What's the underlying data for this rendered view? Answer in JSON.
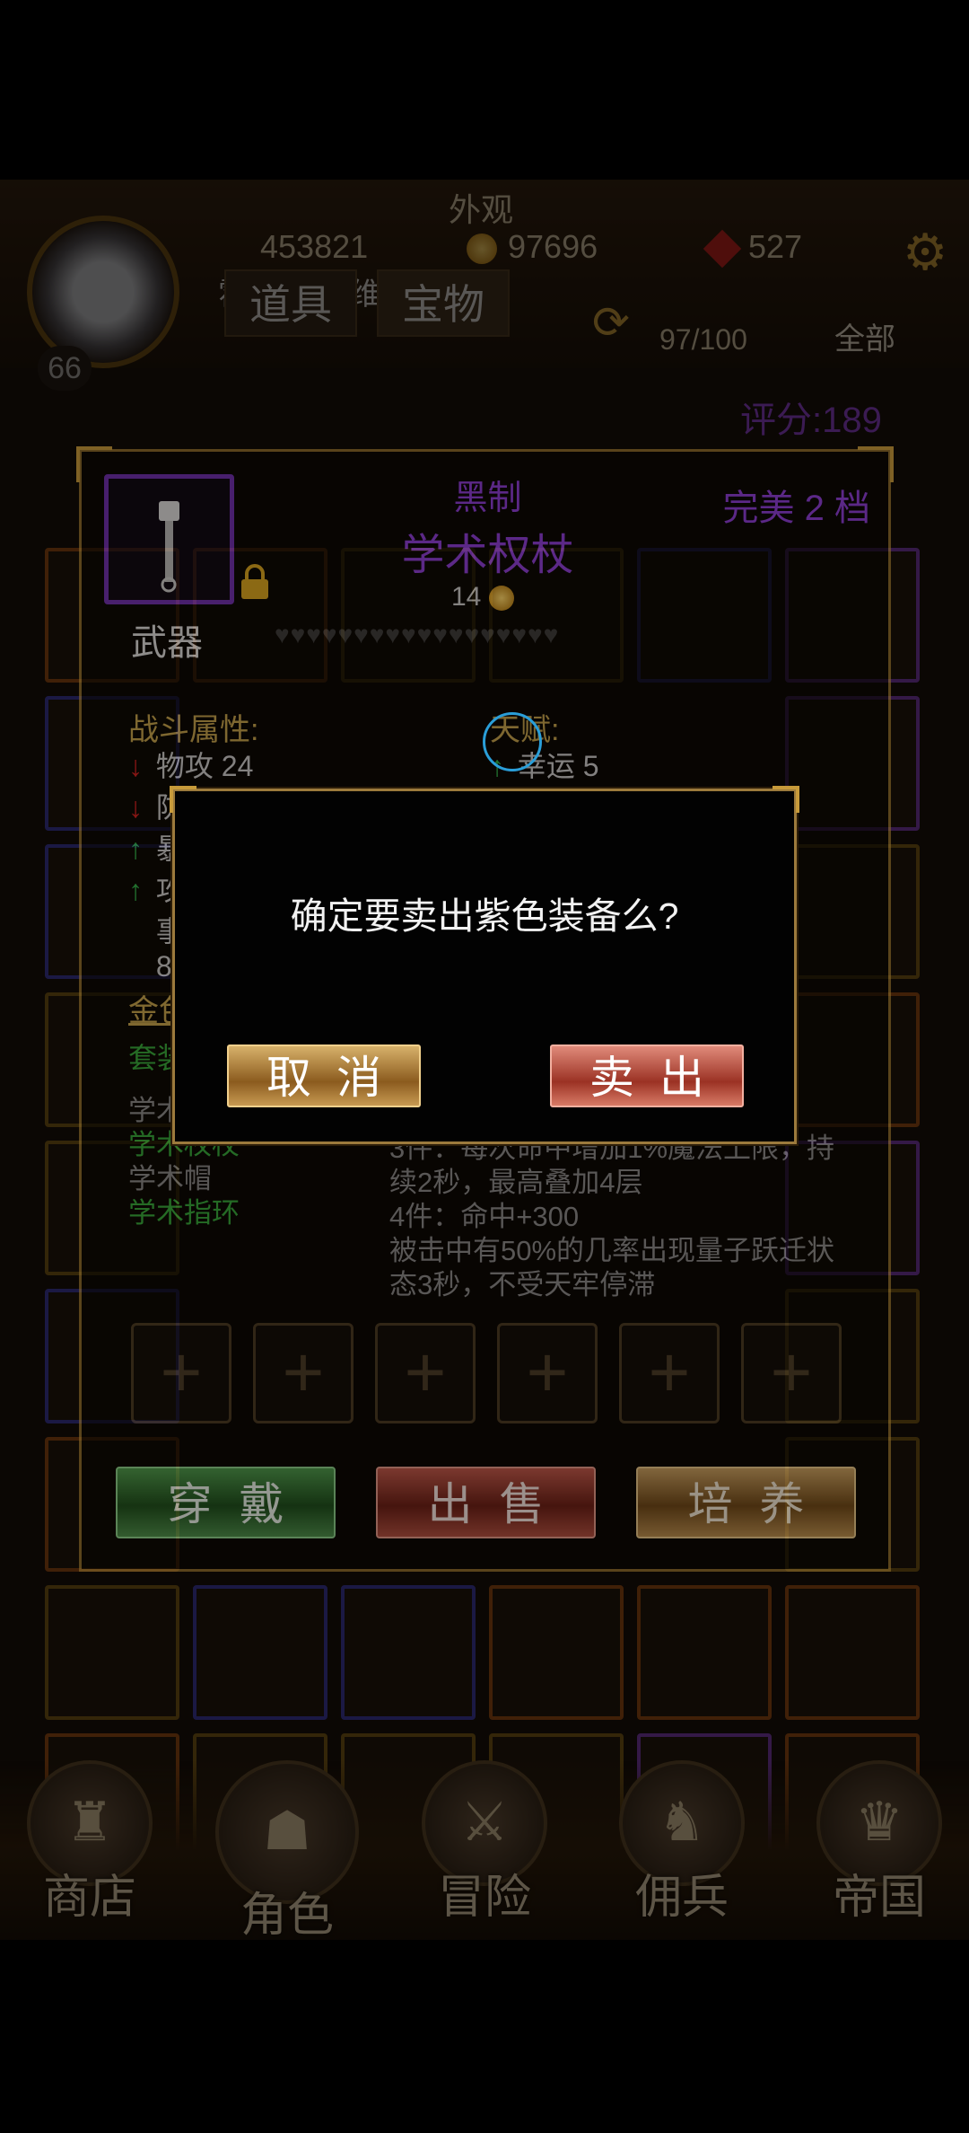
{
  "header": {
    "tab_top_label": "外观",
    "resources": {
      "power": "453821",
      "gold": "97696",
      "gems": "527"
    },
    "player": {
      "name": "霍伯特·戴维斯",
      "level": "66"
    },
    "tabs": [
      "道具",
      "宝物"
    ],
    "bag_count": "97/100",
    "filter_label": "全部",
    "score": "评分:189"
  },
  "item": {
    "quality": "黑制",
    "name": "学术权杖",
    "perfection": "完美 2 档",
    "price": "14",
    "type": "武器",
    "locked": true,
    "hearts_count": 18
  },
  "stats": {
    "combat_title": "战斗属性:",
    "lines": [
      {
        "arrow": "down",
        "text": "物攻 24"
      },
      {
        "arrow": "down",
        "text": "防"
      },
      {
        "arrow": "up",
        "text": "暴"
      },
      {
        "arrow": "up",
        "text": "攻"
      },
      {
        "arrow": "",
        "text": "事"
      },
      {
        "arrow": "",
        "text": "8"
      }
    ],
    "talent_title": "天赋:",
    "talent_lines": [
      {
        "arrow": "up",
        "text": "幸运 5"
      }
    ]
  },
  "set_info": {
    "gold_label": "金色",
    "set_label": "套装",
    "set_items": [
      {
        "text": "学术",
        "active": false
      },
      {
        "text": "学术权杖",
        "active": true
      },
      {
        "text": "学术帽",
        "active": false
      },
      {
        "text": "学术指环",
        "active": true
      }
    ],
    "desc_lines": [
      "3件：每次命中增加1%魔法上限，持",
      "续2秒，最高叠加4层",
      "4件：命中+300",
      "被击中有50%的几率出现量子跃迁状",
      "态3秒，不受天牢停滞"
    ]
  },
  "gem_slots": [
    "+",
    "+",
    "+",
    "+",
    "+",
    "+"
  ],
  "actions": {
    "equip": "穿戴",
    "sell": "出售",
    "train": "培养"
  },
  "dialog": {
    "message": "确定要卖出紫色装备么?",
    "cancel": "取消",
    "confirm": "卖出"
  },
  "nav": [
    {
      "label": "商店",
      "icon": "castle-icon"
    },
    {
      "label": "角色",
      "icon": "hooded-character-icon"
    },
    {
      "label": "冒险",
      "icon": "crossed-swords-icon"
    },
    {
      "label": "佣兵",
      "icon": "mercenary-icon"
    },
    {
      "label": "帝国",
      "icon": "crown-icon"
    }
  ],
  "colors": {
    "purple_quality": "#8d3ed8",
    "gold_text": "#c5a44d",
    "set_active": "#35a93a"
  }
}
